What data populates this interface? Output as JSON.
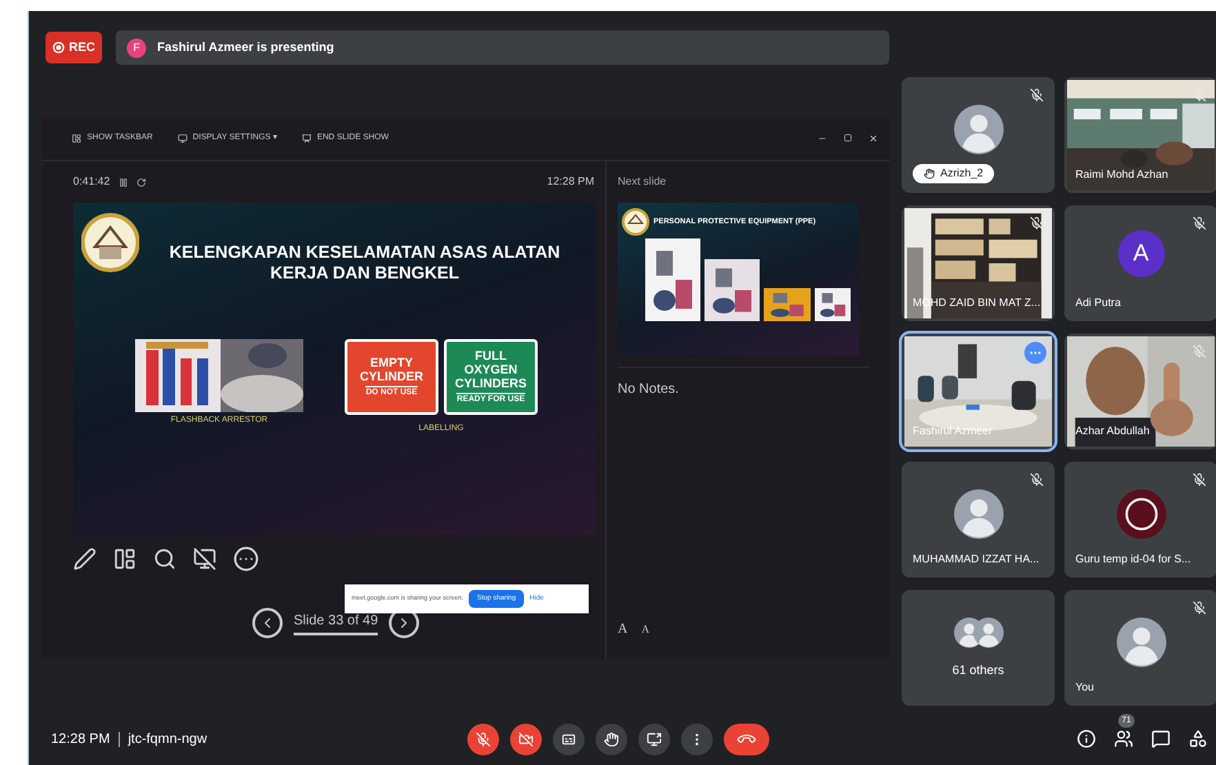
{
  "recording": {
    "label": "REC"
  },
  "presenter_banner": {
    "avatar_letter": "F",
    "text": "Fashirul Azmeer is presenting"
  },
  "presenter_view": {
    "toolbar": [
      {
        "kind": "taskbar",
        "label": "SHOW TASKBAR"
      },
      {
        "kind": "display",
        "label": "DISPLAY SETTINGS ▾"
      },
      {
        "kind": "end",
        "label": "END SLIDE SHOW"
      }
    ],
    "timer": "0:41:42",
    "clock": "12:28 PM",
    "slide": {
      "title": "KELENGKAPAN KESELAMATAN ASAS ALATAN KERJA DAN BENGKEL",
      "photo_caption": "FLASHBACK ARRESTOR",
      "signs_caption": "LABELLING",
      "signs": [
        {
          "lines": [
            "EMPTY",
            "CYLINDER"
          ],
          "sub": "DO NOT USE",
          "color": "#e2462c"
        },
        {
          "lines": [
            "FULL",
            "OXYGEN",
            "CYLINDERS"
          ],
          "sub": "READY FOR USE",
          "color": "#1d8a56"
        }
      ]
    },
    "slide_counter": "Slide 33 of 49",
    "next_slide_label": "Next slide",
    "next_slide_title": "PERSONAL PROTECTIVE EQUIPMENT (PPE)",
    "notes": "No Notes.",
    "font_buttons": [
      "A",
      "A"
    ]
  },
  "share_notice": {
    "text": "meet.google.com is sharing your screen.",
    "stop": "Stop sharing",
    "hide": "Hide"
  },
  "participants": [
    {
      "kind": "avatar",
      "name": "Azrizh_2",
      "muted": true,
      "hand_raised": true
    },
    {
      "kind": "video",
      "name": "Raimi Mohd Azhan",
      "muted": true
    },
    {
      "kind": "video",
      "name": "MOHD ZAID BIN MAT Z...",
      "muted": true
    },
    {
      "kind": "letter",
      "letter": "A",
      "color": "#5b2fc9",
      "name": "Adi Putra",
      "muted": true
    },
    {
      "kind": "video",
      "name": "Fashirul Azmeer",
      "muted": false,
      "selected": true
    },
    {
      "kind": "video",
      "name": "Azhar Abdullah",
      "muted": true,
      "selected": false
    },
    {
      "kind": "avatar",
      "name": "MUHAMMAD IZZAT HA...",
      "muted": true
    },
    {
      "kind": "ring",
      "name": "Guru temp id-04 for S...",
      "muted": true
    },
    {
      "kind": "others",
      "name": "61 others",
      "muted": false
    },
    {
      "kind": "avatar",
      "name": "You",
      "muted": true
    }
  ],
  "bottom_bar": {
    "time": "12:28 PM",
    "meeting_code": "jtc-fqmn-ngw",
    "people_count": "71"
  },
  "controls": [
    {
      "kind": "mic",
      "off": true
    },
    {
      "kind": "camera",
      "off": true
    },
    {
      "kind": "captions",
      "off": false
    },
    {
      "kind": "hand",
      "off": false
    },
    {
      "kind": "present",
      "off": false
    },
    {
      "kind": "more",
      "off": false
    },
    {
      "kind": "leave"
    }
  ]
}
